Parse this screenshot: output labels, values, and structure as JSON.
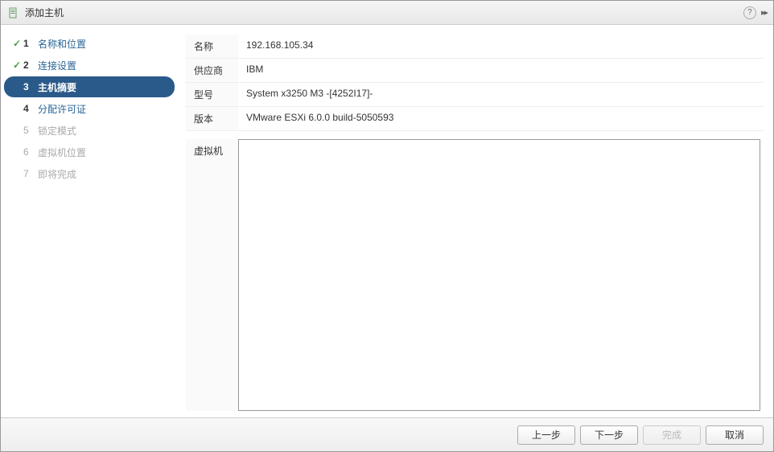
{
  "dialog": {
    "title": "添加主机"
  },
  "sidebar": {
    "steps": [
      {
        "num": "1",
        "label": "名称和位置",
        "state": "completed"
      },
      {
        "num": "2",
        "label": "连接设置",
        "state": "completed"
      },
      {
        "num": "3",
        "label": "主机摘要",
        "state": "active"
      },
      {
        "num": "4",
        "label": "分配许可证",
        "state": "next"
      },
      {
        "num": "5",
        "label": "锁定模式",
        "state": "disabled"
      },
      {
        "num": "6",
        "label": "虚拟机位置",
        "state": "disabled"
      },
      {
        "num": "7",
        "label": "即将完成",
        "state": "disabled"
      }
    ]
  },
  "summary": {
    "name_label": "名称",
    "name_value": "192.168.105.34",
    "vendor_label": "供应商",
    "vendor_value": "IBM",
    "model_label": "型号",
    "model_value": "System x3250 M3 -[4252I17]-",
    "version_label": "版本",
    "version_value": "VMware ESXi 6.0.0 build-5050593",
    "vm_label": "虚拟机"
  },
  "footer": {
    "back": "上一步",
    "next": "下一步",
    "finish": "完成",
    "cancel": "取消"
  }
}
